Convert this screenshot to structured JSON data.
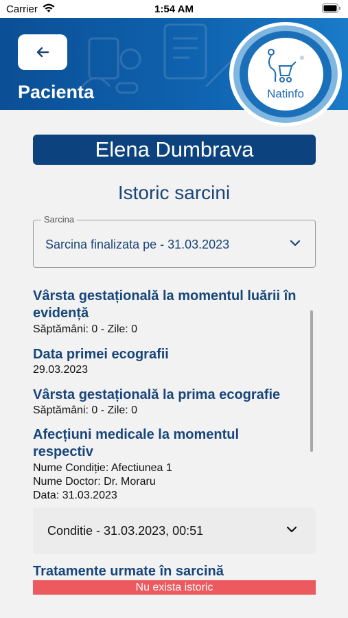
{
  "status_bar": {
    "carrier": "Carrier",
    "time": "1:54 AM"
  },
  "header": {
    "title": "Pacienta",
    "back_icon": "arrow-left-icon"
  },
  "logo": {
    "text": "Natinfo",
    "reg": "®"
  },
  "patient": {
    "name": "Elena Dumbrava"
  },
  "section_title": "Istoric sarcini",
  "pregnancy_select": {
    "label": "Sarcina",
    "value": "Sarcina finalizata pe - 31.03.2023"
  },
  "details": {
    "gest_age_registration": {
      "heading": "Vârsta gestațională la momentul luării în evidență",
      "value": "Săptămâni: 0 - Zile: 0"
    },
    "first_ultrasound_date": {
      "heading": "Data primei ecografii",
      "value": "29.03.2023"
    },
    "gest_age_first_ultrasound": {
      "heading": "Vârsta gestațională la prima ecografie",
      "value": "Săptămâni: 0 - Zile: 0"
    },
    "medical_conditions": {
      "heading": "Afecțiuni medicale la momentul respectiv",
      "lines": [
        "Nume Condiție: Afectiunea 1",
        "Nume Doctor: Dr. Moraru",
        "Data: 31.03.2023"
      ]
    }
  },
  "condition_card": {
    "label": "Conditie - 31.03.2023, 00:51"
  },
  "treatments": {
    "heading": "Tratamente urmate în sarcină",
    "empty_message": "Nu exista istoric"
  },
  "colors": {
    "header_blue": "#0f62ae",
    "banner_navy": "#0c427e",
    "heading_blue": "#17457a",
    "alert_red": "#ec5a5f"
  }
}
